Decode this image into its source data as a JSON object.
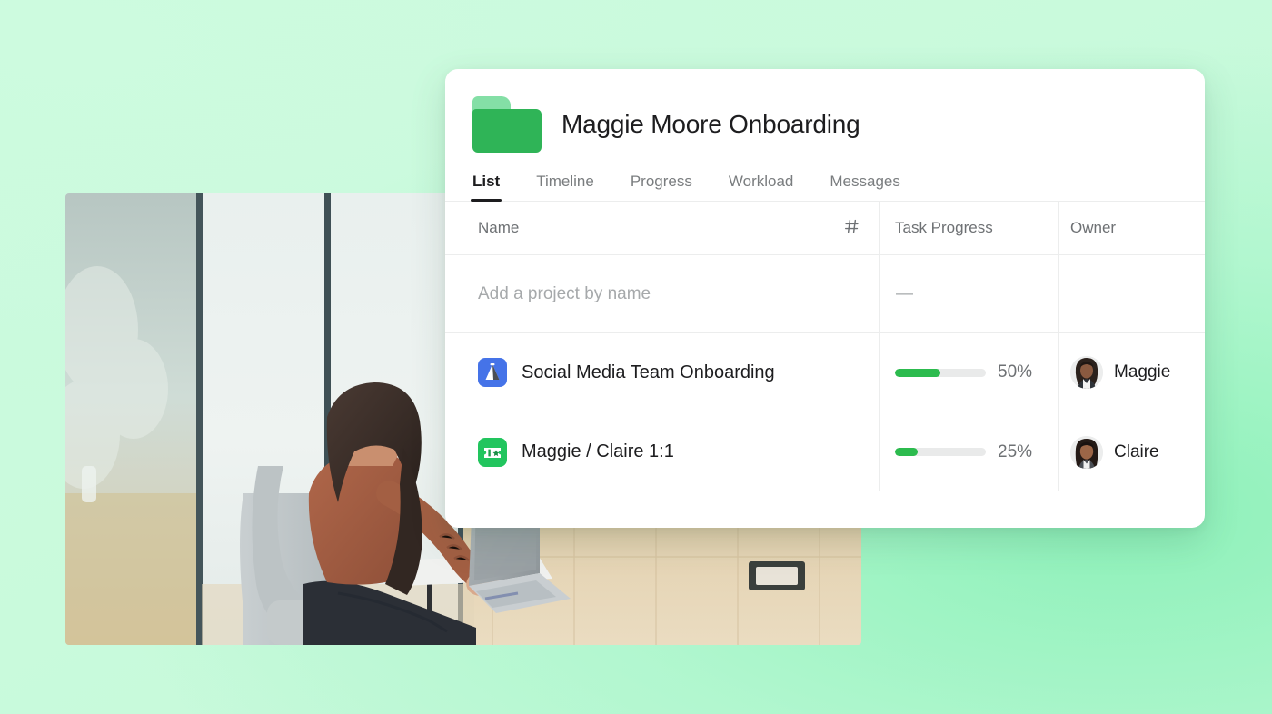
{
  "theme": {
    "background_color": "#c9fadc",
    "card_background": "#ffffff",
    "accent_green": "#2cbb4e",
    "folder_green": "#2fb457",
    "folder_tab_green": "#84dfa6",
    "text_primary": "#1d1d1f",
    "text_secondary": "#6e7174",
    "placeholder_color": "#a6a9ab",
    "divider_color": "#eceded"
  },
  "photo": {
    "alt": "Woman working on a laptop seated in a chair by large windows"
  },
  "header": {
    "folder_icon": "folder-icon",
    "title": "Maggie Moore Onboarding"
  },
  "tabs": [
    {
      "label": "List",
      "active": true
    },
    {
      "label": "Timeline",
      "active": false
    },
    {
      "label": "Progress",
      "active": false
    },
    {
      "label": "Workload",
      "active": false
    },
    {
      "label": "Messages",
      "active": false
    }
  ],
  "table": {
    "columns": [
      {
        "label": "Name",
        "icon": "hash-icon"
      },
      {
        "label": "Task Progress"
      },
      {
        "label": "Owner"
      }
    ],
    "add_row": {
      "placeholder": "Add a project by name",
      "progress_value": "—",
      "owner": ""
    },
    "rows": [
      {
        "icon": "flask-icon",
        "icon_color": "#4573e8",
        "name": "Social Media Team Onboarding",
        "progress_pct": 50,
        "progress_label": "50%",
        "owner": "Maggie"
      },
      {
        "icon": "ticket-star-icon",
        "icon_color": "#22c55e",
        "name": "Maggie / Claire 1:1",
        "progress_pct": 25,
        "progress_label": "25%",
        "owner": "Claire"
      }
    ]
  }
}
